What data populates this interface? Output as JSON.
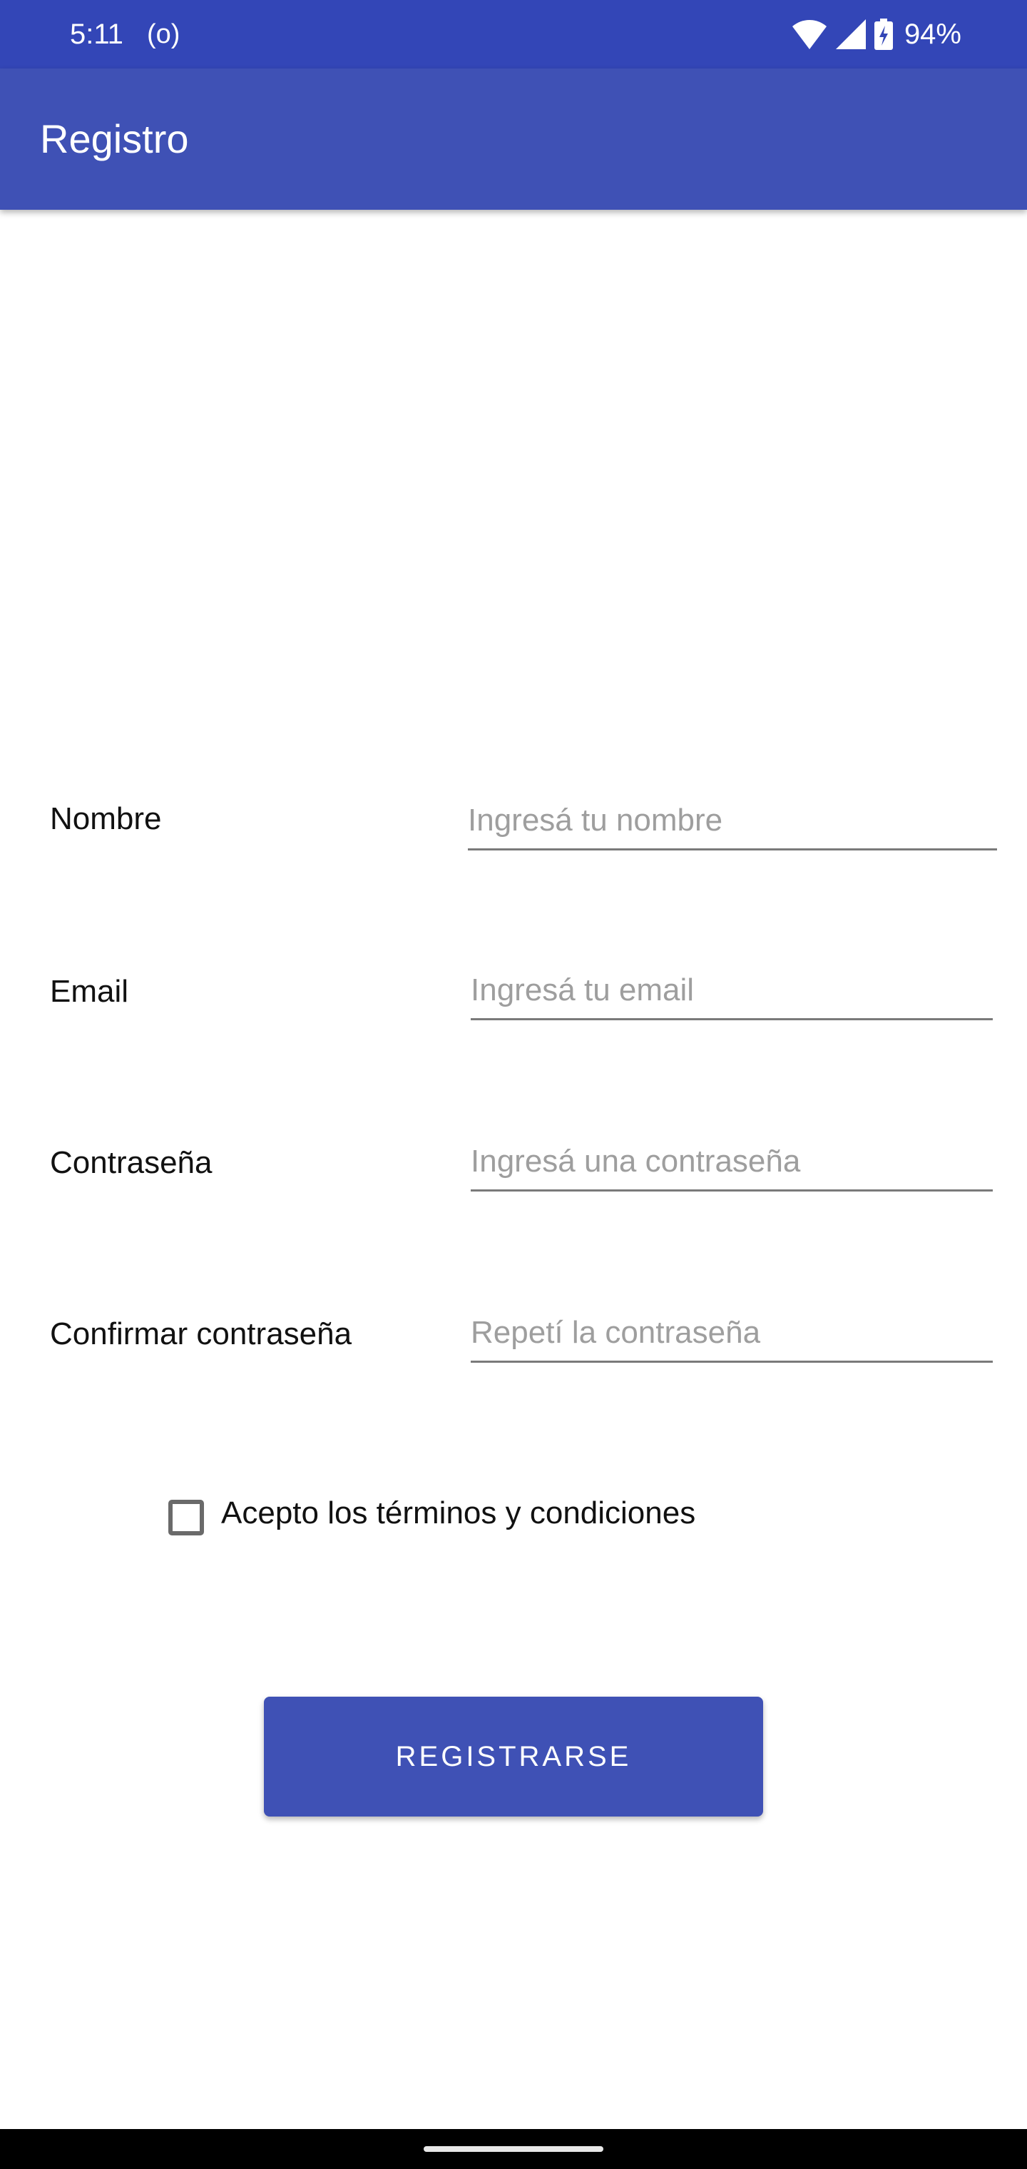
{
  "status_bar": {
    "time": "5:11",
    "radio_indicator": "(o)",
    "battery_percent": "94%",
    "icons": [
      "wifi-icon",
      "cellular-signal-icon",
      "battery-charging-icon"
    ]
  },
  "app_bar": {
    "title": "Registro"
  },
  "form": {
    "name": {
      "label": "Nombre",
      "placeholder": "Ingresá tu nombre",
      "value": ""
    },
    "email": {
      "label": "Email",
      "placeholder": "Ingresá tu email",
      "value": ""
    },
    "password": {
      "label": "Contraseña",
      "placeholder": "Ingresá una contraseña",
      "value": ""
    },
    "confirm_password": {
      "label": "Confirmar contraseña",
      "placeholder": "Repetí la contraseña",
      "value": ""
    },
    "terms": {
      "label": "Acepto los términos y condiciones",
      "checked": false
    },
    "submit_label": "REGISTRARSE"
  },
  "colors": {
    "status_bar": "#3346b7",
    "primary": "#3f51b5",
    "text": "#111111",
    "hint": "#9e9e9e",
    "underline": "#7a7a7a"
  }
}
